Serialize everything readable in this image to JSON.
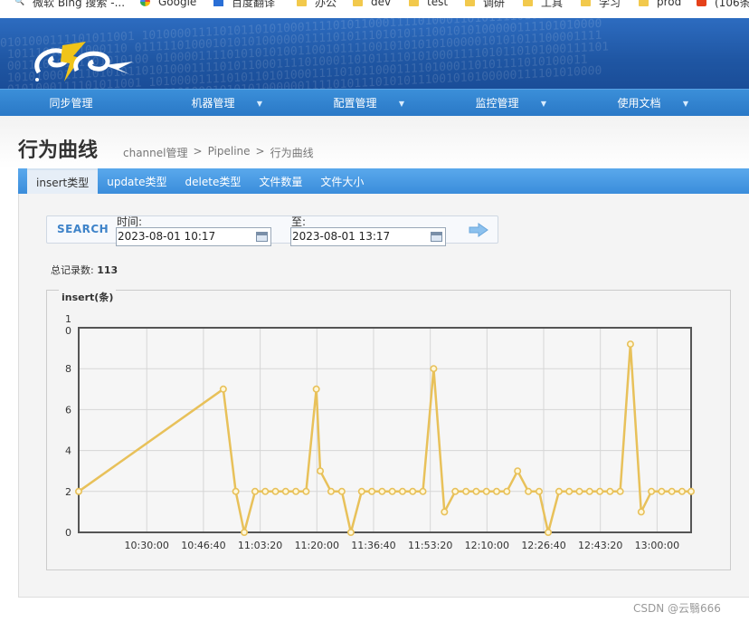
{
  "bookmarks": [
    {
      "label": "微软 Bing 搜索 -...",
      "icon": "search-icon"
    },
    {
      "label": "Google",
      "icon": "google-icon"
    },
    {
      "label": "百度翻译",
      "icon": "translate-icon"
    },
    {
      "label": "办公",
      "icon": "folder-icon"
    },
    {
      "label": "dev",
      "icon": "folder-icon"
    },
    {
      "label": "test",
      "icon": "folder-icon"
    },
    {
      "label": "调研",
      "icon": "folder-icon"
    },
    {
      "label": "工具",
      "icon": "folder-icon"
    },
    {
      "label": "学习",
      "icon": "folder-icon"
    },
    {
      "label": "prod",
      "icon": "folder-icon"
    },
    {
      "label": "(106条",
      "icon": "csdn-icon"
    }
  ],
  "nav": [
    {
      "label": "同步管理",
      "dropdown": false
    },
    {
      "label": "机器管理",
      "dropdown": true
    },
    {
      "label": "配置管理",
      "dropdown": true
    },
    {
      "label": "监控管理",
      "dropdown": true
    },
    {
      "label": "使用文档",
      "dropdown": true
    }
  ],
  "page": {
    "title": "行为曲线",
    "breadcrumb": [
      "channel管理",
      ">",
      "Pipeline",
      ">",
      "行为曲线"
    ]
  },
  "tabs": [
    {
      "label": "insert类型",
      "active": true
    },
    {
      "label": "update类型",
      "active": false
    },
    {
      "label": "delete类型",
      "active": false
    },
    {
      "label": "文件数量",
      "active": false
    },
    {
      "label": "文件大小",
      "active": false
    }
  ],
  "search": {
    "label": "SEARCH",
    "time_label": "时间:",
    "from_value": "2023-08-01 10:17",
    "to_label": "至:",
    "to_value": "2023-08-01 13:17"
  },
  "summary": {
    "label": "总记录数:",
    "count": "113"
  },
  "chart_legend": "insert(条)",
  "watermark": "CSDN @云翳666",
  "colors": {
    "line": "#e8c15a",
    "nav": "#2a78c6",
    "banner": "#1f56a3"
  },
  "chart_data": {
    "type": "line",
    "title": "insert(条)",
    "xlabel": "",
    "ylabel": "",
    "ylim": [
      0,
      10
    ],
    "y_ticks": [
      "0",
      "2",
      "4",
      "6",
      "8",
      "1\n0"
    ],
    "x_ticks": [
      "10:30:00",
      "10:46:40",
      "11:03:20",
      "11:20:00",
      "11:36:40",
      "11:53:20",
      "12:10:00",
      "12:26:40",
      "12:43:20",
      "13:00:00"
    ],
    "x_tick_seconds": [
      37800,
      38800,
      39800,
      40800,
      41800,
      42800,
      43800,
      44800,
      45800,
      46800
    ],
    "xlim_seconds": [
      36600,
      47400
    ],
    "series": [
      {
        "x_seconds": [
          36600,
          39150,
          39370,
          39520,
          39710,
          39890,
          40070,
          40250,
          40430,
          40610,
          40790,
          40860,
          41050,
          41240,
          41400,
          41590,
          41770,
          41950,
          42130,
          42310,
          42490,
          42670,
          42860,
          43050,
          43240,
          43430,
          43610,
          43790,
          43970,
          44150,
          44340,
          44530,
          44720,
          44880,
          45070,
          45250,
          45430,
          45610,
          45790,
          45970,
          46150,
          46330,
          46520,
          46700,
          46880,
          47060,
          47240,
          47400
        ],
        "values": [
          2,
          7,
          2,
          0,
          2,
          2,
          2,
          2,
          2,
          2,
          7,
          3,
          2,
          2,
          0,
          2,
          2,
          2,
          2,
          2,
          2,
          2,
          8,
          1,
          2,
          2,
          2,
          2,
          2,
          2,
          3,
          2,
          2,
          0,
          2,
          2,
          2,
          2,
          2,
          2,
          2,
          9.2,
          1,
          2,
          2,
          2,
          2,
          2
        ]
      }
    ],
    "grid": true
  }
}
